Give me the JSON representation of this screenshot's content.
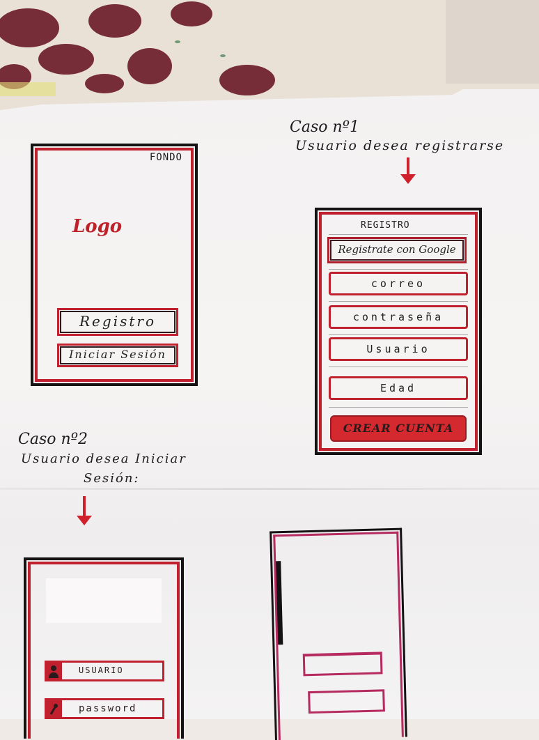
{
  "colors": {
    "ink": "#1e1b1f",
    "accent_red": "#c1212e",
    "pink": "#b52a5f",
    "paper": "#f4f2f2"
  },
  "home_screen": {
    "background_note": "FONDO",
    "logo_text": "Logo",
    "register_button": "Registro",
    "login_button": "Iniciar Sesión"
  },
  "case1": {
    "title": "Caso nº1",
    "subtitle": "Usuario desea registrarse",
    "arrow_icon": "arrow-down-icon"
  },
  "register_screen": {
    "title": "REGISTRO",
    "google_button": "Registrate con Google",
    "fields": [
      "correo",
      "contraseña",
      "Usuario",
      "Edad"
    ],
    "create_button": "CREAR CUENTA"
  },
  "case2": {
    "title": "Caso nº2",
    "subtitle_line1": "Usuario desea Iniciar",
    "subtitle_line2": "Sesión:",
    "arrow_icon": "arrow-down-icon"
  },
  "login_screen": {
    "user_field": "USUARIO",
    "password_field": "password",
    "user_icon": "person-icon",
    "password_icon": "key-icon"
  }
}
